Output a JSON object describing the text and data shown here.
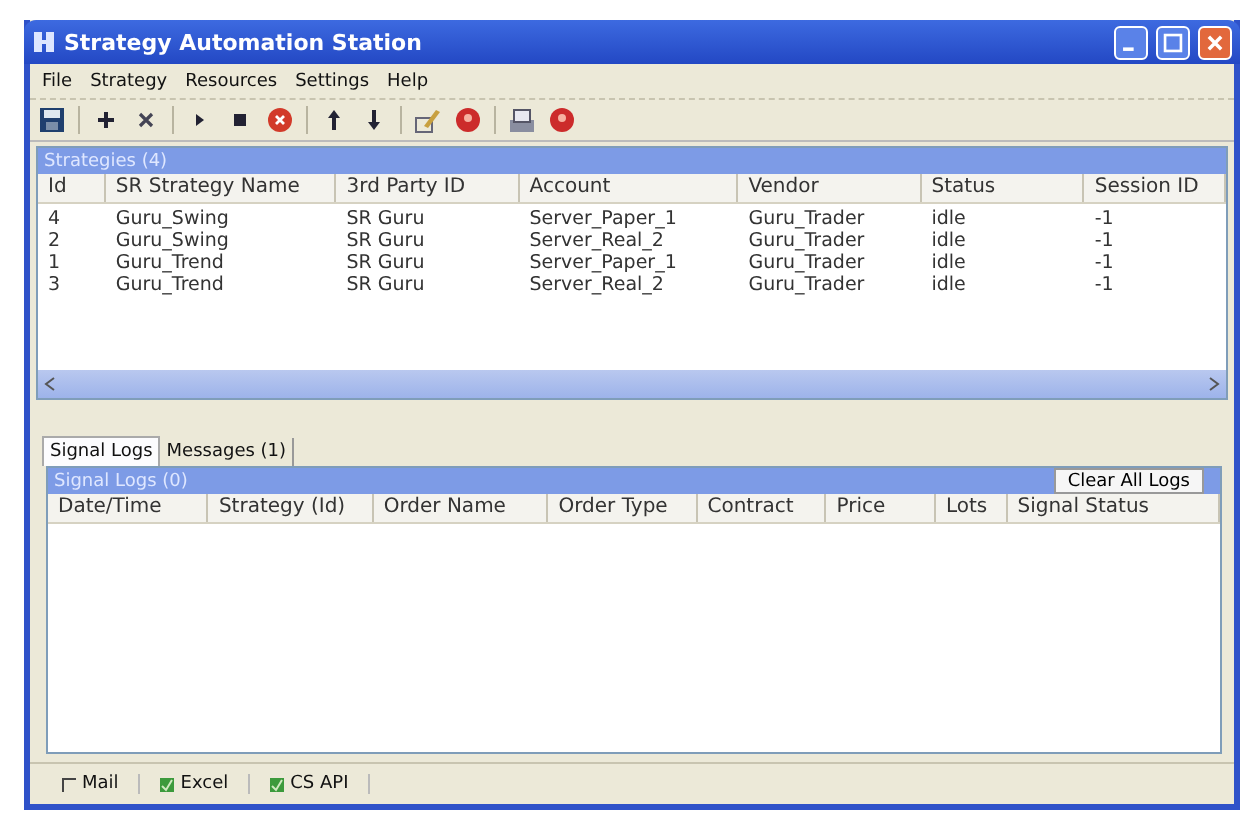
{
  "window": {
    "title": "Strategy Automation Station"
  },
  "menu": [
    "File",
    "Strategy",
    "Resources",
    "Settings",
    "Help"
  ],
  "toolbar": [
    {
      "buttons": [
        {
          "kind": "save"
        }
      ]
    },
    {
      "buttons": [
        {
          "kind": "add"
        },
        {
          "kind": "delete"
        }
      ]
    },
    {
      "buttons": [
        {
          "kind": "play"
        },
        {
          "kind": "stop"
        },
        {
          "kind": "cancel"
        }
      ]
    },
    {
      "buttons": [
        {
          "kind": "up"
        },
        {
          "kind": "down"
        }
      ]
    },
    {
      "buttons": [
        {
          "kind": "edit"
        },
        {
          "kind": "alert"
        }
      ]
    },
    {
      "buttons": [
        {
          "kind": "tray"
        },
        {
          "kind": "alert"
        }
      ]
    }
  ],
  "strategies": {
    "title": "Strategies (4)",
    "columns": [
      "Id",
      "SR Strategy Name",
      "3rd Party ID",
      "Account",
      "Vendor",
      "Status",
      "Session ID"
    ],
    "rows": [
      [
        "4",
        "Guru_Swing",
        "SR Guru",
        "Server_Paper_1",
        "Guru_Trader",
        "idle",
        "-1"
      ],
      [
        "2",
        "Guru_Swing",
        "SR Guru",
        "Server_Real_2",
        "Guru_Trader",
        "idle",
        "-1"
      ],
      [
        "1",
        "Guru_Trend",
        "SR Guru",
        "Server_Paper_1",
        "Guru_Trader",
        "idle",
        "-1"
      ],
      [
        "3",
        "Guru_Trend",
        "SR Guru",
        "Server_Real_2",
        "Guru_Trader",
        "idle",
        "-1"
      ]
    ]
  },
  "tabs": [
    {
      "label": "Signal Logs",
      "selected": true
    },
    {
      "label": "Messages (1)",
      "selected": false
    }
  ],
  "signal_logs": {
    "title": "Signal Logs (0)",
    "clear_button": "Clear All Logs",
    "columns": [
      "Date/Time",
      "Strategy (Id)",
      "Order Name",
      "Order Type",
      "Contract",
      "Price",
      "Lots",
      "Signal Status"
    ]
  },
  "status_bar": [
    {
      "label": "Mail",
      "checked": false
    },
    {
      "label": "Excel",
      "checked": true
    },
    {
      "label": "CS API",
      "checked": true
    }
  ]
}
